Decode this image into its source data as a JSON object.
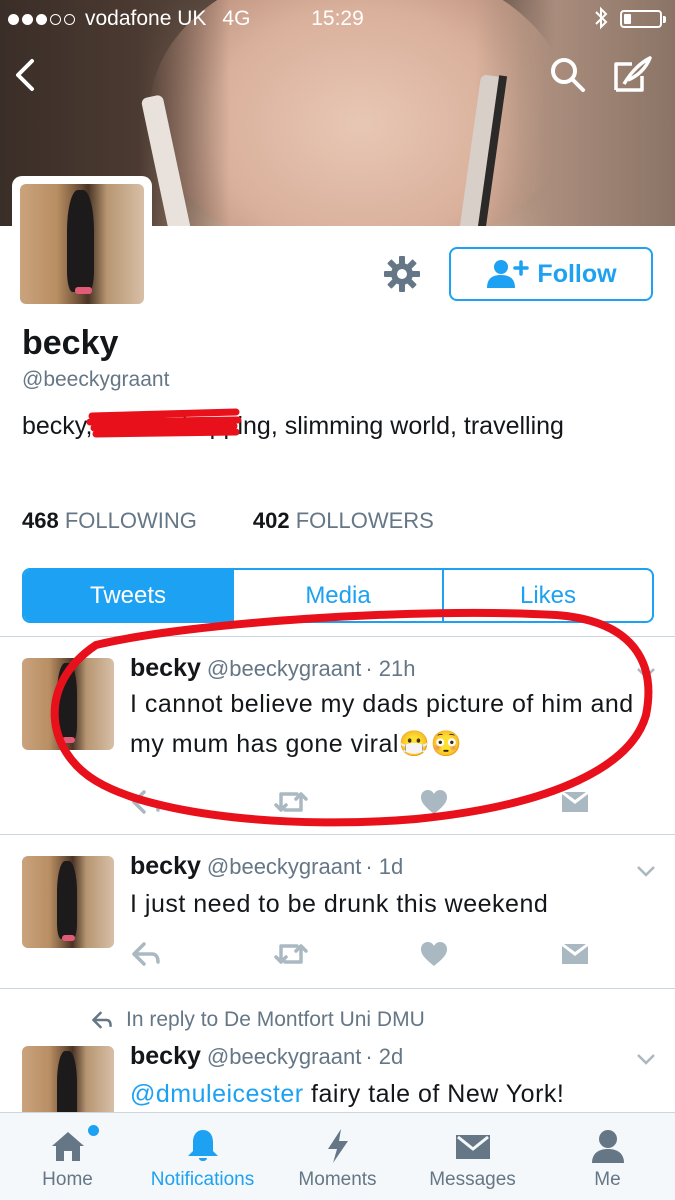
{
  "status_bar": {
    "carrier": "vodafone UK",
    "network": "4G",
    "time": "15:29",
    "battery_level": 0.2
  },
  "profile": {
    "name": "becky",
    "handle": "@beeckygraant",
    "bio_part1": "becky, ",
    "bio_part2": "shopping, slimming world, travelling",
    "following_count": "468",
    "following_label": "FOLLOWING",
    "followers_count": "402",
    "followers_label": "FOLLOWERS",
    "follow_label": "Follow"
  },
  "tabs": [
    {
      "label": "Tweets",
      "active": true
    },
    {
      "label": "Media",
      "active": false
    },
    {
      "label": "Likes",
      "active": false
    }
  ],
  "tweets": [
    {
      "name": "becky",
      "handle": "@beeckygraant",
      "time": "· 21h",
      "text": "I cannot believe my dads picture of him and my mum has gone viral😷😳"
    },
    {
      "name": "becky",
      "handle": "@beeckygraant",
      "time": "· 1d",
      "text": "I just need to be drunk this weekend"
    },
    {
      "reply_context": "In reply to De Montfort Uni DMU",
      "name": "becky",
      "handle": "@beeckygraant",
      "time": "· 2d",
      "mention": "@dmuleicester",
      "text": " fairy tale of New York!"
    }
  ],
  "tabbar": [
    {
      "label": "Home",
      "icon": "home-icon"
    },
    {
      "label": "Notifications",
      "icon": "bell-icon",
      "active": true
    },
    {
      "label": "Moments",
      "icon": "lightning-icon"
    },
    {
      "label": "Messages",
      "icon": "envelope-icon"
    },
    {
      "label": "Me",
      "icon": "person-icon"
    }
  ],
  "colors": {
    "accent": "#1da1f2",
    "secondary_text": "#657786",
    "annotation": "#e8101a"
  }
}
